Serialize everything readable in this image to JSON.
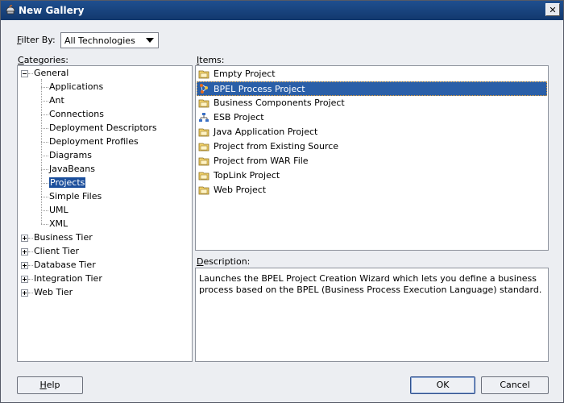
{
  "window": {
    "title": "New Gallery",
    "close_label": "✕"
  },
  "filter": {
    "label_prefix": "F",
    "label_rest": "ilter By:",
    "selected": "All Technologies"
  },
  "categories": {
    "label_prefix": "C",
    "label_rest": "ategories:",
    "general": "General",
    "general_children": [
      "Applications",
      "Ant",
      "Connections",
      "Deployment Descriptors",
      "Deployment Profiles",
      "Diagrams",
      "JavaBeans",
      "Projects",
      "Simple Files",
      "UML",
      "XML"
    ],
    "collapsed": [
      "Business Tier",
      "Client Tier",
      "Database Tier",
      "Integration Tier",
      "Web Tier"
    ]
  },
  "items": {
    "label_prefix": "I",
    "label_rest": "tems:",
    "list": [
      {
        "label": "Empty Project",
        "icon": "folder-icon"
      },
      {
        "label": "BPEL Process Project",
        "icon": "bpel-process-icon"
      },
      {
        "label": "Business Components Project",
        "icon": "folder-icon"
      },
      {
        "label": "ESB Project",
        "icon": "esb-icon"
      },
      {
        "label": "Java Application Project",
        "icon": "folder-icon"
      },
      {
        "label": "Project from Existing Source",
        "icon": "folder-icon"
      },
      {
        "label": "Project from WAR File",
        "icon": "folder-icon"
      },
      {
        "label": "TopLink Project",
        "icon": "folder-icon"
      },
      {
        "label": "Web Project",
        "icon": "folder-icon"
      }
    ]
  },
  "description": {
    "label_prefix": "D",
    "label_rest": "escription:",
    "text": "Launches the BPEL Project Creation Wizard which lets you define a business process based on the BPEL (Business Process Execution Language) standard."
  },
  "buttons": {
    "help_prefix": "H",
    "help_rest": "elp",
    "ok": "OK",
    "cancel": "Cancel"
  },
  "colors": {
    "title_bar": "#1f4f8f",
    "selection": "#2a5fa8",
    "folder": "#f2d36b"
  }
}
